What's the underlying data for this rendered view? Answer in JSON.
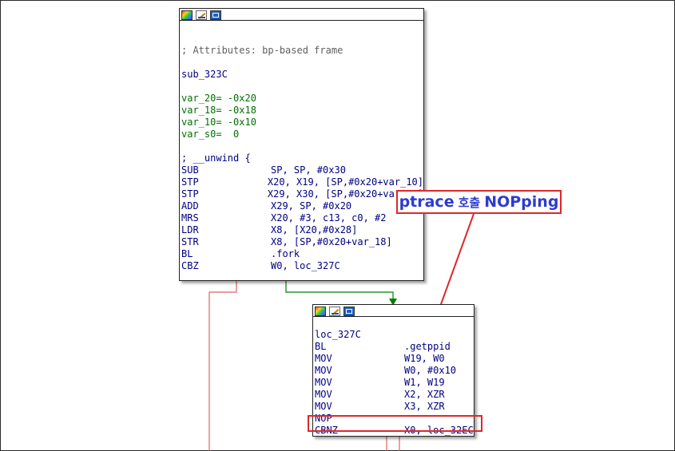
{
  "node1": {
    "lines": [
      {
        "kind": "blank",
        "text": ""
      },
      {
        "kind": "blank",
        "text": ""
      },
      {
        "kind": "comment",
        "text": "; Attributes: bp-based frame"
      },
      {
        "kind": "blank",
        "text": ""
      },
      {
        "kind": "label",
        "text": "sub_323C"
      },
      {
        "kind": "blank",
        "text": ""
      },
      {
        "kind": "var",
        "text": "var_20= -0x20"
      },
      {
        "kind": "var",
        "text": "var_18= -0x18"
      },
      {
        "kind": "var",
        "text": "var_10= -0x10"
      },
      {
        "kind": "var",
        "text": "var_s0=  0"
      },
      {
        "kind": "blank",
        "text": ""
      },
      {
        "kind": "label",
        "text": "; __unwind {"
      },
      {
        "kind": "ins",
        "mnemonic": "SUB",
        "operands": "SP, SP, #0x30"
      },
      {
        "kind": "ins",
        "mnemonic": "STP",
        "operands": "X20, X19, [SP,#0x20+var_10]"
      },
      {
        "kind": "ins",
        "mnemonic": "STP",
        "operands": "X29, X30, [SP,#0x20+var_s0]"
      },
      {
        "kind": "ins",
        "mnemonic": "ADD",
        "operands": "X29, SP, #0x20"
      },
      {
        "kind": "ins",
        "mnemonic": "MRS",
        "operands": "X20, #3, c13, c0, #2"
      },
      {
        "kind": "ins",
        "mnemonic": "LDR",
        "operands": "X8, [X20,#0x28]"
      },
      {
        "kind": "ins",
        "mnemonic": "STR",
        "operands": "X8, [SP,#0x20+var_18]"
      },
      {
        "kind": "ins",
        "mnemonic": "BL",
        "operands": ".fork"
      },
      {
        "kind": "ins",
        "mnemonic": "CBZ",
        "operands": "W0, loc_327C"
      }
    ]
  },
  "node2": {
    "lines": [
      {
        "kind": "blank",
        "text": ""
      },
      {
        "kind": "label",
        "text": "loc_327C"
      },
      {
        "kind": "ins",
        "mnemonic": "BL",
        "operands": ".getppid"
      },
      {
        "kind": "ins",
        "mnemonic": "MOV",
        "operands": "W19, W0"
      },
      {
        "kind": "ins",
        "mnemonic": "MOV",
        "operands": "W0, #0x10"
      },
      {
        "kind": "ins",
        "mnemonic": "MOV",
        "operands": "W1, W19"
      },
      {
        "kind": "ins",
        "mnemonic": "MOV",
        "operands": "X2, XZR"
      },
      {
        "kind": "ins",
        "mnemonic": "MOV",
        "operands": "X3, XZR"
      },
      {
        "kind": "ins",
        "mnemonic": "NOP",
        "operands": ""
      },
      {
        "kind": "ins",
        "mnemonic": "CBNZ",
        "operands": "X0, loc_32EC"
      }
    ]
  },
  "callout": {
    "part1": "ptrace",
    "part2": "호출",
    "part3": "NOPping"
  },
  "colors": {
    "accent": "#e0262a",
    "callout_text": "#2e3bd0",
    "edge_true": "#008000",
    "edge_false": "#e06060"
  }
}
